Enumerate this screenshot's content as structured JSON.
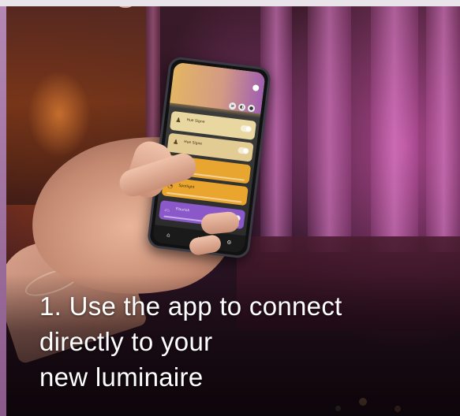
{
  "caption": {
    "line1": "1. Use the app to connect",
    "line2": "directly to your",
    "line3": "new luminaire"
  },
  "phone_app": {
    "tiles": [
      {
        "label": "Hue Signe",
        "icon": "lamp-icon"
      },
      {
        "label": "Hue Signe",
        "icon": "lamp-icon"
      },
      {
        "label": "",
        "icon": "lamp-icon"
      },
      {
        "label": "Spotlight",
        "icon": "spot-icon"
      },
      {
        "label": "Flourish",
        "icon": "ceiling-light-icon"
      }
    ],
    "nav": [
      "home-icon",
      "explore-icon",
      "settings-icon"
    ]
  },
  "colors": {
    "caption_text": "#ffffff",
    "accent_purple": "#8a58c8",
    "accent_amber": "#e8a630",
    "header_gradient_start": "#e3b564",
    "header_gradient_end": "#a05fb0"
  }
}
